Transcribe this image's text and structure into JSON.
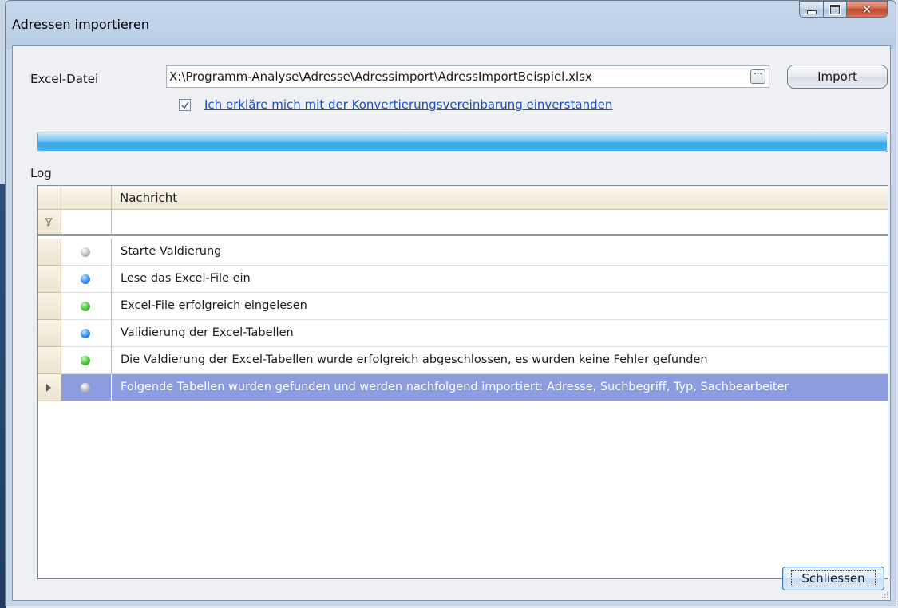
{
  "window": {
    "title": "Adressen importieren",
    "buttons": [
      "minimize",
      "maximize",
      "close"
    ]
  },
  "form": {
    "excel_label": "Excel-Datei",
    "file_path": "X:\\Programm-Analyse\\Adresse\\Adressimport\\AdressImportBeispiel.xlsx",
    "browse_label": "···",
    "import_label": "Import",
    "consent_checked": true,
    "consent_text": "Ich erkläre mich mit der Konvertierungsvereinbarung einverstanden"
  },
  "progress": {
    "fraction": 1.0
  },
  "log": {
    "label": "Log",
    "column_header": "Nachricht",
    "rows": [
      {
        "status": "gray",
        "message": "Starte Valdierung"
      },
      {
        "status": "blue",
        "message": "Lese das Excel-File ein"
      },
      {
        "status": "green",
        "message": "Excel-File erfolgreich eingelesen"
      },
      {
        "status": "blue",
        "message": "Validierung der Excel-Tabellen"
      },
      {
        "status": "green",
        "message": "Die Valdierung der Excel-Tabellen wurde erfolgreich abgeschlossen, es wurden keine Fehler gefunden"
      },
      {
        "status": "gray",
        "message": "Folgende Tabellen wurden gefunden und werden nachfolgend importiert: Adresse, Suchbegriff, Typ, Sachbearbeiter",
        "selected": true
      }
    ]
  },
  "footer": {
    "close_label": "Schliessen"
  }
}
